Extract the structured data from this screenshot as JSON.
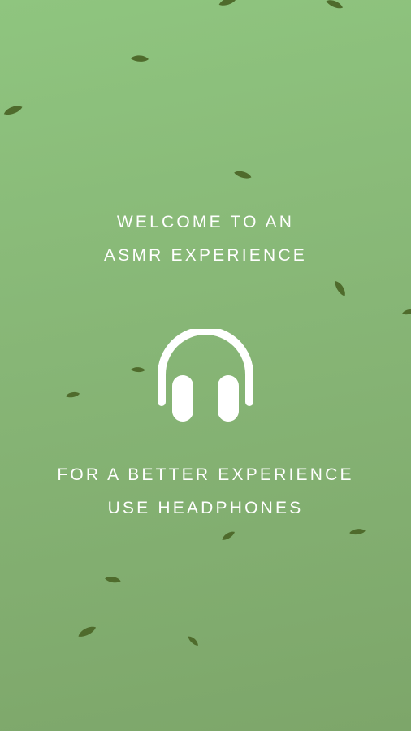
{
  "welcome": {
    "line1": "WELCOME TO AN",
    "line2": "ASMR EXPERIENCE"
  },
  "advice": {
    "line1": "FOR A BETTER EXPERIENCE",
    "line2": "USE HEADPHONES"
  },
  "icons": {
    "center": "headphones-icon",
    "decoration": "leaf-icon"
  },
  "colors": {
    "background_top": "#8fc57f",
    "background_bottom": "#7da66a",
    "text": "#ffffff",
    "leaf": "#4f6b2c"
  }
}
